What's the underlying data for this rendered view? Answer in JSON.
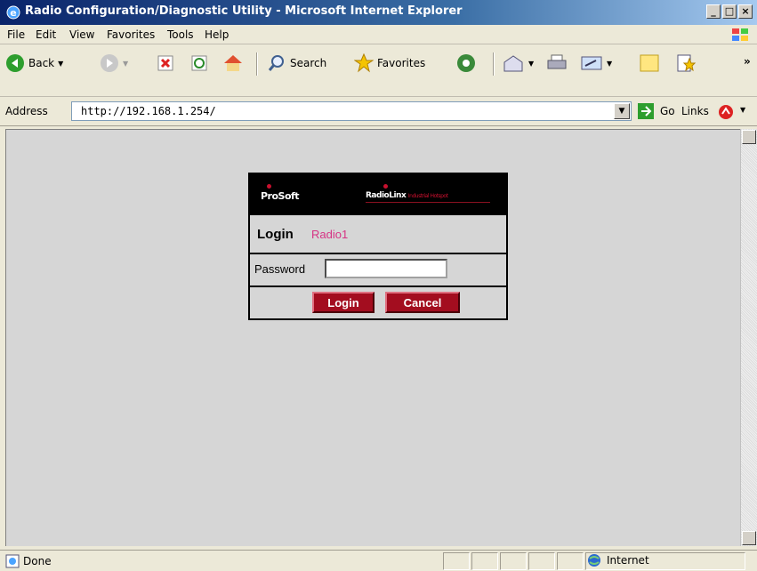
{
  "window": {
    "title": "Radio Configuration/Diagnostic Utility - Microsoft Internet Explorer"
  },
  "menu": [
    "File",
    "Edit",
    "View",
    "Favorites",
    "Tools",
    "Help"
  ],
  "toolbar": {
    "back": "Back",
    "search": "Search",
    "favorites": "Favorites"
  },
  "address": {
    "label": "Address",
    "url": "http://192.168.1.254/",
    "go": "Go",
    "links": "Links"
  },
  "page": {
    "brand_left": "ProSoft",
    "brand_right": "RadioLinx",
    "brand_tagline": "Industrial Hotspot",
    "login_title": "Login",
    "radio_name": "Radio1",
    "password_label": "Password",
    "password_value": "",
    "login_button": "Login",
    "cancel_button": "Cancel"
  },
  "status": {
    "text": "Done",
    "zone": "Internet"
  }
}
